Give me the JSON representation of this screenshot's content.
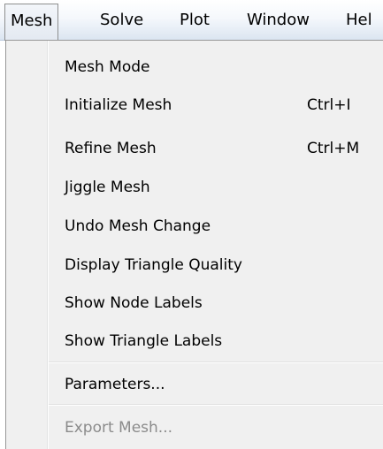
{
  "menubar": {
    "items": [
      {
        "label": "Mesh",
        "active": true
      },
      {
        "label": "Solve"
      },
      {
        "label": "Plot"
      },
      {
        "label": "Window"
      },
      {
        "label": "Hel"
      }
    ]
  },
  "mesh_menu": {
    "items": [
      {
        "label": "Mesh Mode",
        "shortcut": ""
      },
      {
        "label": "Initialize Mesh",
        "shortcut": "Ctrl+I"
      },
      {
        "label": "Refine Mesh",
        "shortcut": "Ctrl+M"
      },
      {
        "label": "Jiggle Mesh",
        "shortcut": ""
      },
      {
        "label": "Undo Mesh Change",
        "shortcut": ""
      },
      {
        "label": "Display Triangle Quality",
        "shortcut": ""
      },
      {
        "label": "Show Node Labels",
        "shortcut": ""
      },
      {
        "label": "Show Triangle Labels",
        "shortcut": ""
      },
      {
        "label": "Parameters...",
        "shortcut": ""
      },
      {
        "label": "Export Mesh...",
        "shortcut": "",
        "disabled": true
      }
    ]
  },
  "colors": {
    "menu_background": "#f0f0f0",
    "disabled_text": "#8b8b8b",
    "menubar_gradient_bottom": "#dbe5f1"
  }
}
